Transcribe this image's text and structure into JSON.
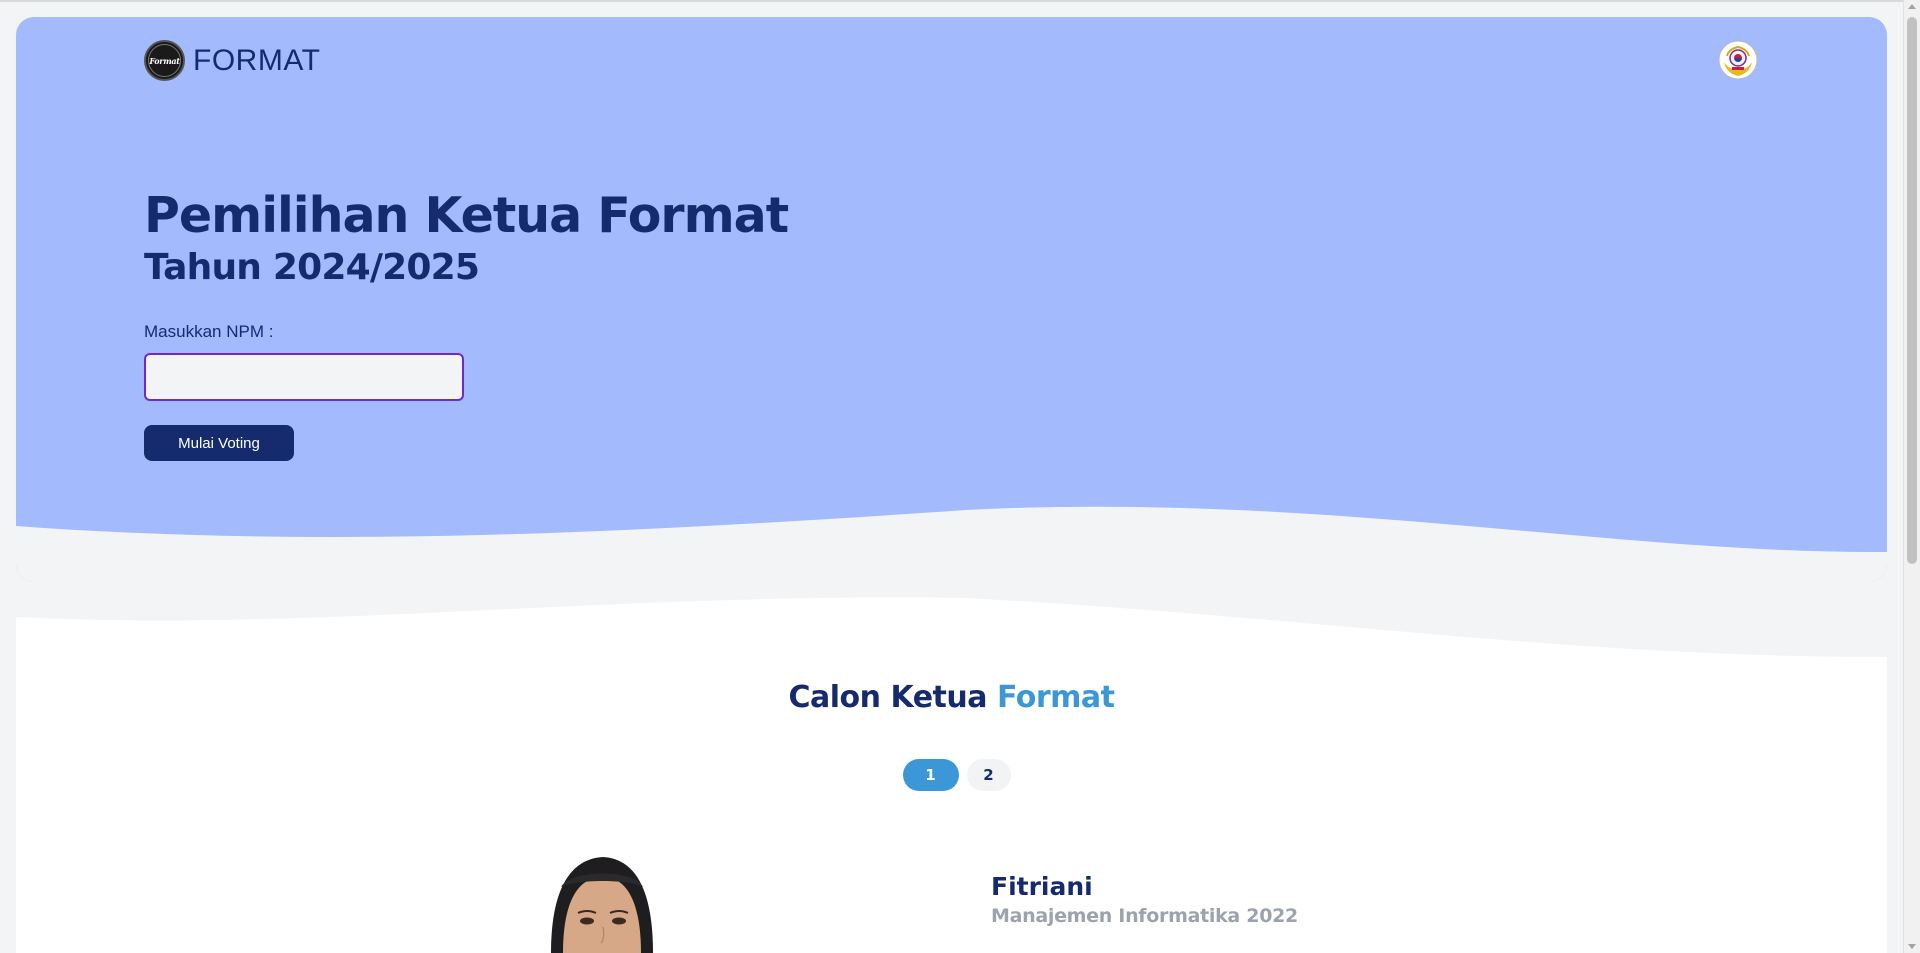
{
  "header": {
    "brand_name": "FORMAT",
    "brand_logo_text": "Format",
    "brand_logo_icon": "format-logo-icon",
    "campus_logo_icon": "campus-emblem-icon"
  },
  "hero": {
    "title": "Pemilihan Ketua Format",
    "subtitle": "Tahun 2024/2025",
    "npm_label": "Masukkan NPM :",
    "npm_value": "",
    "npm_placeholder": "",
    "start_button_label": "Mulai Voting"
  },
  "candidates_section": {
    "title_part_dark": "Calon Ketua",
    "title_part_accent": "Format",
    "pages": [
      "1",
      "2"
    ],
    "active_page": "1",
    "candidate": {
      "name": "Fitriani",
      "major": "Manajemen Informatika 2022"
    }
  },
  "colors": {
    "hero_background": "#a3bbfd",
    "navy": "#152b6e",
    "accent": "#3b97d6",
    "input_border": "#6d28d9",
    "muted": "#9ca3af",
    "page_background": "#f3f4f6"
  }
}
